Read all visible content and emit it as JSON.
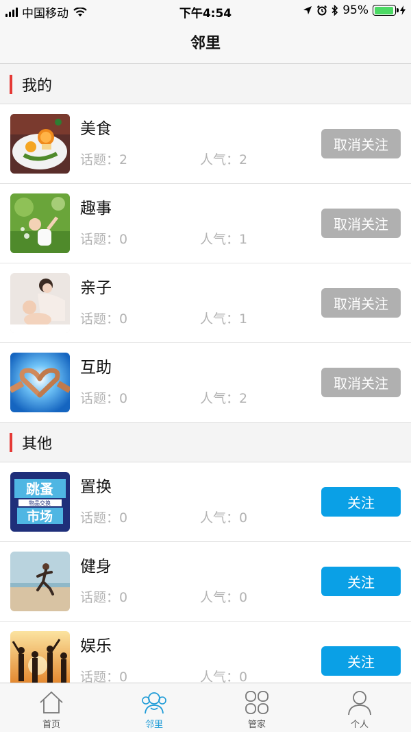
{
  "status_bar": {
    "carrier": "中国移动",
    "time": "下午4:54",
    "battery": "95%"
  },
  "nav": {
    "title": "邻里"
  },
  "sections": [
    {
      "title": "我的",
      "items": [
        {
          "name": "美食",
          "topics": "话题：2",
          "popularity": "人气：2",
          "button": "取消关注",
          "icon": "food-image"
        },
        {
          "name": "趣事",
          "topics": "话题：0",
          "popularity": "人气：1",
          "button": "取消关注",
          "icon": "child-bubbles-image"
        },
        {
          "name": "亲子",
          "topics": "话题：0",
          "popularity": "人气：1",
          "button": "取消关注",
          "icon": "mother-baby-image"
        },
        {
          "name": "互助",
          "topics": "话题：0",
          "popularity": "人气：2",
          "button": "取消关注",
          "icon": "heart-hands-image"
        }
      ]
    },
    {
      "title": "其他",
      "items": [
        {
          "name": "置换",
          "topics": "话题：0",
          "popularity": "人气：0",
          "button": "关注",
          "icon": "flea-market-image",
          "poster_text": [
            "跳蚤",
            "物品交换",
            "市场"
          ]
        },
        {
          "name": "健身",
          "topics": "话题：0",
          "popularity": "人气：0",
          "button": "关注",
          "icon": "runner-beach-image"
        },
        {
          "name": "娱乐",
          "topics": "话题：0",
          "popularity": "人气：0",
          "button": "关注",
          "icon": "party-silhouettes-image"
        }
      ]
    }
  ],
  "tabs": [
    {
      "label": "首页",
      "icon": "home-icon",
      "active": false
    },
    {
      "label": "邻里",
      "icon": "neighbors-icon",
      "active": true
    },
    {
      "label": "管家",
      "icon": "grid-icon",
      "active": false
    },
    {
      "label": "个人",
      "icon": "person-icon",
      "active": false
    }
  ],
  "colors": {
    "accent": "#0aa0e6",
    "unfollow": "#b0b0b0",
    "section_bar": "#e53935",
    "tab_active": "#1e9bd7"
  }
}
